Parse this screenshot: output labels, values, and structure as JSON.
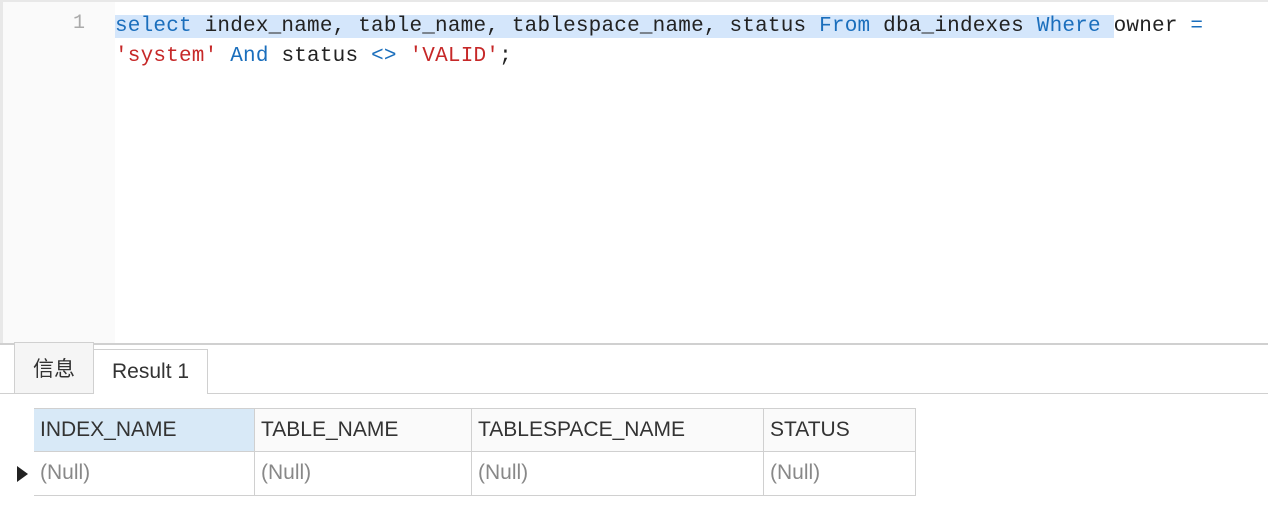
{
  "editor": {
    "lineNumber": "1",
    "tokens": [
      {
        "text": "select",
        "cls": "kw",
        "sel": true
      },
      {
        "text": " index_name, table_name, tablespace_name, status ",
        "cls": "plain",
        "sel": true
      },
      {
        "text": "From",
        "cls": "kw",
        "sel": true
      },
      {
        "text": " dba_indexes ",
        "cls": "plain",
        "sel": true
      },
      {
        "text": "Where",
        "cls": "kw",
        "sel": true
      },
      {
        "text": " ",
        "cls": "plain",
        "sel": true
      },
      {
        "text": "owner ",
        "cls": "plain",
        "sel": false
      },
      {
        "text": "=",
        "cls": "kw",
        "sel": false
      },
      {
        "text": " ",
        "cls": "plain",
        "sel": false
      },
      {
        "text": "'system'",
        "cls": "str",
        "sel": false
      },
      {
        "text": " ",
        "cls": "plain",
        "sel": false
      },
      {
        "text": "And",
        "cls": "kw",
        "sel": false
      },
      {
        "text": " status ",
        "cls": "plain",
        "sel": false
      },
      {
        "text": "<>",
        "cls": "kw",
        "sel": false
      },
      {
        "text": " ",
        "cls": "plain",
        "sel": false
      },
      {
        "text": "'VALID'",
        "cls": "str",
        "sel": false
      },
      {
        "text": ";",
        "cls": "plain",
        "sel": false
      }
    ]
  },
  "tabs": [
    {
      "label": "信息",
      "active": false
    },
    {
      "label": "Result 1",
      "active": true
    }
  ],
  "grid": {
    "headers": [
      "INDEX_NAME",
      "TABLE_NAME",
      "TABLESPACE_NAME",
      "STATUS"
    ],
    "sortedCol": 0,
    "rows": [
      [
        "(Null)",
        "(Null)",
        "(Null)",
        "(Null)"
      ]
    ]
  }
}
